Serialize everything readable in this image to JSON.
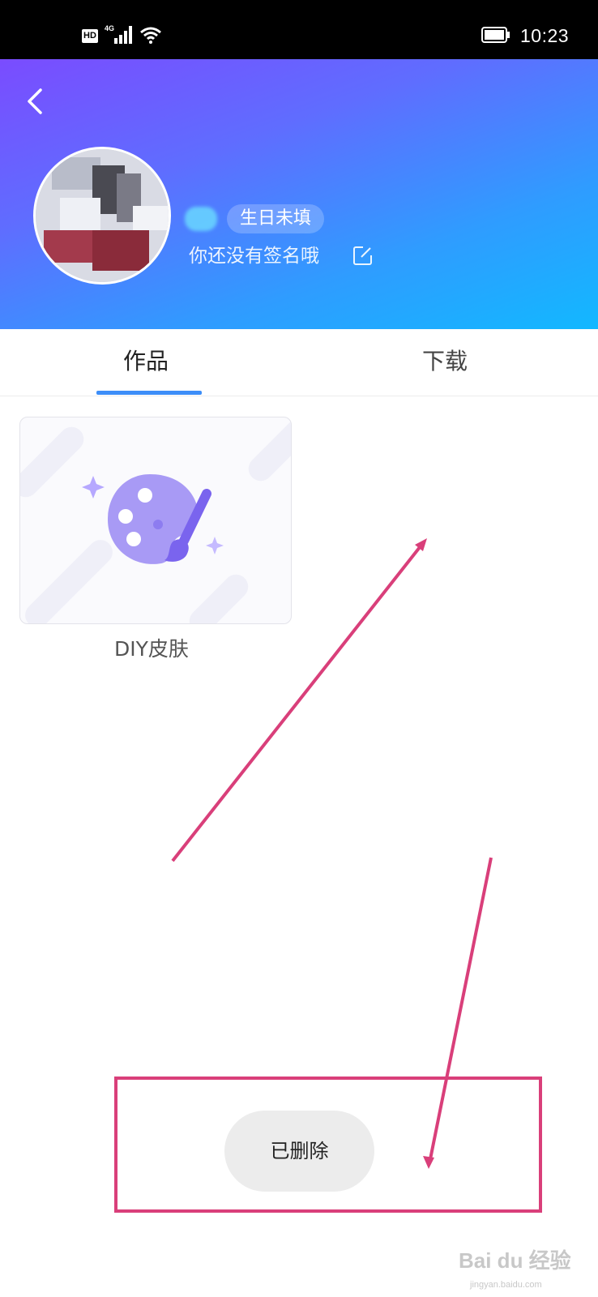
{
  "status_bar": {
    "hd_label": "HD",
    "network_label": "4G",
    "time": "10:23",
    "icons": [
      "hd-icon",
      "signal-icon",
      "wifi-icon",
      "battery-icon"
    ]
  },
  "header": {
    "back_icon": "chevron-left-icon",
    "birthday_badge": "生日未填",
    "signature": "你还没有签名哦",
    "edit_icon": "edit-icon",
    "colors": {
      "gradient_start": "#7a4cff",
      "gradient_end": "#12b8ff"
    }
  },
  "tabs": {
    "items": [
      {
        "label": "作品",
        "active": true
      },
      {
        "label": "下载",
        "active": false
      }
    ],
    "indicator_color": "#3d8ef8"
  },
  "works": {
    "items": [
      {
        "label": "DIY皮肤",
        "icon": "palette-icon"
      }
    ]
  },
  "toast": {
    "text": "已删除"
  },
  "annotation": {
    "color": "#d93f7a"
  },
  "watermark": {
    "text": "Bai du 经验",
    "url": "jingyan.baidu.com"
  }
}
